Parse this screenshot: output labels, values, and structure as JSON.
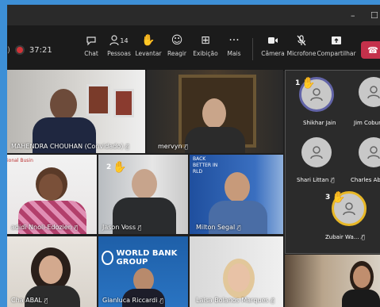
{
  "window": {
    "minimize": "–",
    "restore": "☐"
  },
  "toolbar": {
    "timer": "37:21",
    "chat": "Chat",
    "people": "Pessoas",
    "people_count": "14",
    "raise": "Levantar",
    "react": "Reagir",
    "view": "Exibição",
    "more": "Mais",
    "camera": "Câmera",
    "mic": "Microfone",
    "share": "Compartilhar"
  },
  "tiles": [
    {
      "name": "MAHENDRA CHOUHAN (Convidado)"
    },
    {
      "name": "mervyn"
    },
    {
      "name": "adidi Nnoli-Edozien",
      "banner": "ional Busin"
    },
    {
      "name": "Jason Voss",
      "hand": "2"
    },
    {
      "name": "Milton Segal",
      "banner": "BACK\nBETTER IN\nRLD"
    },
    {
      "name": "Cha ABAL"
    },
    {
      "name": "Gianluca Riccardi",
      "banner": "WORLD BANK GROUP"
    },
    {
      "name": "Laisa Bolanos Marques"
    },
    {
      "name": ""
    }
  ],
  "side": [
    {
      "name": "Shikhar Jain",
      "hand": "1"
    },
    {
      "name": "Jim Cobum"
    },
    {
      "name": "Shari Littan"
    },
    {
      "name": "Charles Ab"
    },
    {
      "name": "Zubair Wa...",
      "hand": "3"
    }
  ],
  "colors": {
    "accent": "#6264a7",
    "hand": "#f5c400",
    "leave": "#c4314b",
    "selected": "#e8b827"
  }
}
